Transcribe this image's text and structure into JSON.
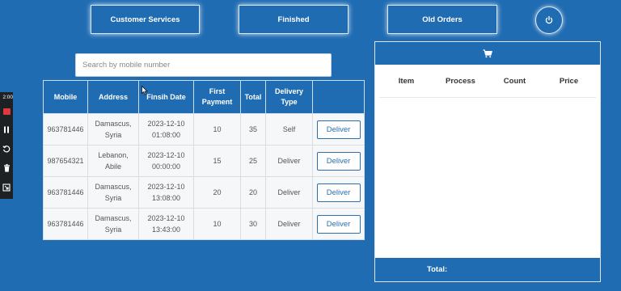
{
  "nav": {
    "customer_services": "Customer Services",
    "finished": "Finished",
    "old_orders": "Old Orders"
  },
  "search": {
    "placeholder": "Search by mobile number",
    "value": ""
  },
  "table": {
    "headers": {
      "mobile": "Mobile",
      "address": "Address",
      "finish_date": "Finsih Date",
      "first_payment_line1": "First",
      "first_payment_line2": "Payment",
      "total": "Total",
      "delivery_type_line1": "Delivery",
      "delivery_type_line2": "Type"
    },
    "rows": [
      {
        "mobile": "963781446",
        "address_line1": "Damascus,",
        "address_line2": "Syria",
        "date": "2023-12-10",
        "time": "01:08:00",
        "first_payment": "10",
        "total": "35",
        "delivery_type": "Self",
        "action": "Deliver"
      },
      {
        "mobile": "987654321",
        "address_line1": "Lebanon,",
        "address_line2": "Abile",
        "date": "2023-12-10",
        "time": "00:00:00",
        "first_payment": "15",
        "total": "25",
        "delivery_type": "Deliver",
        "action": "Deliver"
      },
      {
        "mobile": "963781446",
        "address_line1": "Damascus,",
        "address_line2": "Syria",
        "date": "2023-12-10",
        "time": "13:08:00",
        "first_payment": "20",
        "total": "20",
        "delivery_type": "Deliver",
        "action": "Deliver"
      },
      {
        "mobile": "963781446",
        "address_line1": "Damascus,",
        "address_line2": "Syria",
        "date": "2023-12-10",
        "time": "13:43:00",
        "first_payment": "10",
        "total": "30",
        "delivery_type": "Deliver",
        "action": "Deliver"
      }
    ]
  },
  "cart": {
    "columns": {
      "item": "Item",
      "process": "Process",
      "count": "Count",
      "price": "Price"
    },
    "total_label": "Total:"
  },
  "recorder": {
    "time": "2:00"
  },
  "icons": {
    "power": "power-icon",
    "cart": "shopping-cart-icon",
    "pause": "pause-icon",
    "restart": "restart-icon",
    "trash": "trash-icon",
    "export": "export-icon"
  },
  "colors": {
    "background": "#1f6cb3",
    "button_border": "#dbe8f5",
    "deliver_button": "#2c6fb0",
    "record_red": "#e0383e"
  }
}
